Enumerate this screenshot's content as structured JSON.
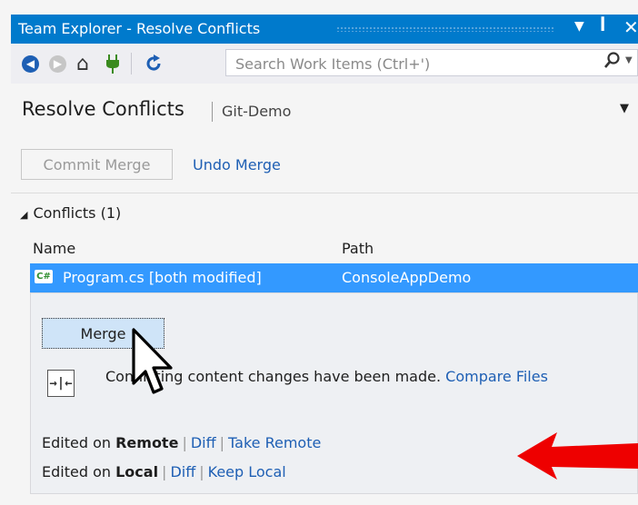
{
  "window": {
    "title": "Team Explorer - Resolve Conflicts",
    "dropdown_glyph": "▼",
    "pin_glyph": "ꟾ",
    "close_glyph": "✕"
  },
  "toolbar": {
    "search_placeholder": "Search Work Items (Ctrl+')",
    "icons": [
      "back-icon",
      "forward-icon",
      "home-icon",
      "plug-icon",
      "refresh-icon",
      "search-icon"
    ]
  },
  "header": {
    "title": "Resolve Conflicts",
    "subtitle": "Git-Demo"
  },
  "actions": {
    "commit_label": "Commit Merge",
    "undo_label": "Undo Merge"
  },
  "conflicts": {
    "section_label": "Conflicts (1)",
    "columns": {
      "name": "Name",
      "path": "Path"
    },
    "rows": [
      {
        "icon_text": "C#",
        "name": "Program.cs [both modified]",
        "path": "ConsoleAppDemo"
      }
    ]
  },
  "detail": {
    "merge_label": "Merge",
    "conflict_text": "Conflicting content changes have been made.",
    "compare_label": "Compare Files",
    "remote": {
      "prefix": "Edited on",
      "source": "Remote",
      "diff": "Diff",
      "take": "Take Remote"
    },
    "local": {
      "prefix": "Edited on",
      "source": "Local",
      "diff": "Diff",
      "keep": "Keep Local"
    }
  },
  "colors": {
    "title_bar": "#007acc",
    "selection": "#3399ff",
    "link": "#1e5fb4",
    "annotation_arrow": "#ee0000"
  }
}
